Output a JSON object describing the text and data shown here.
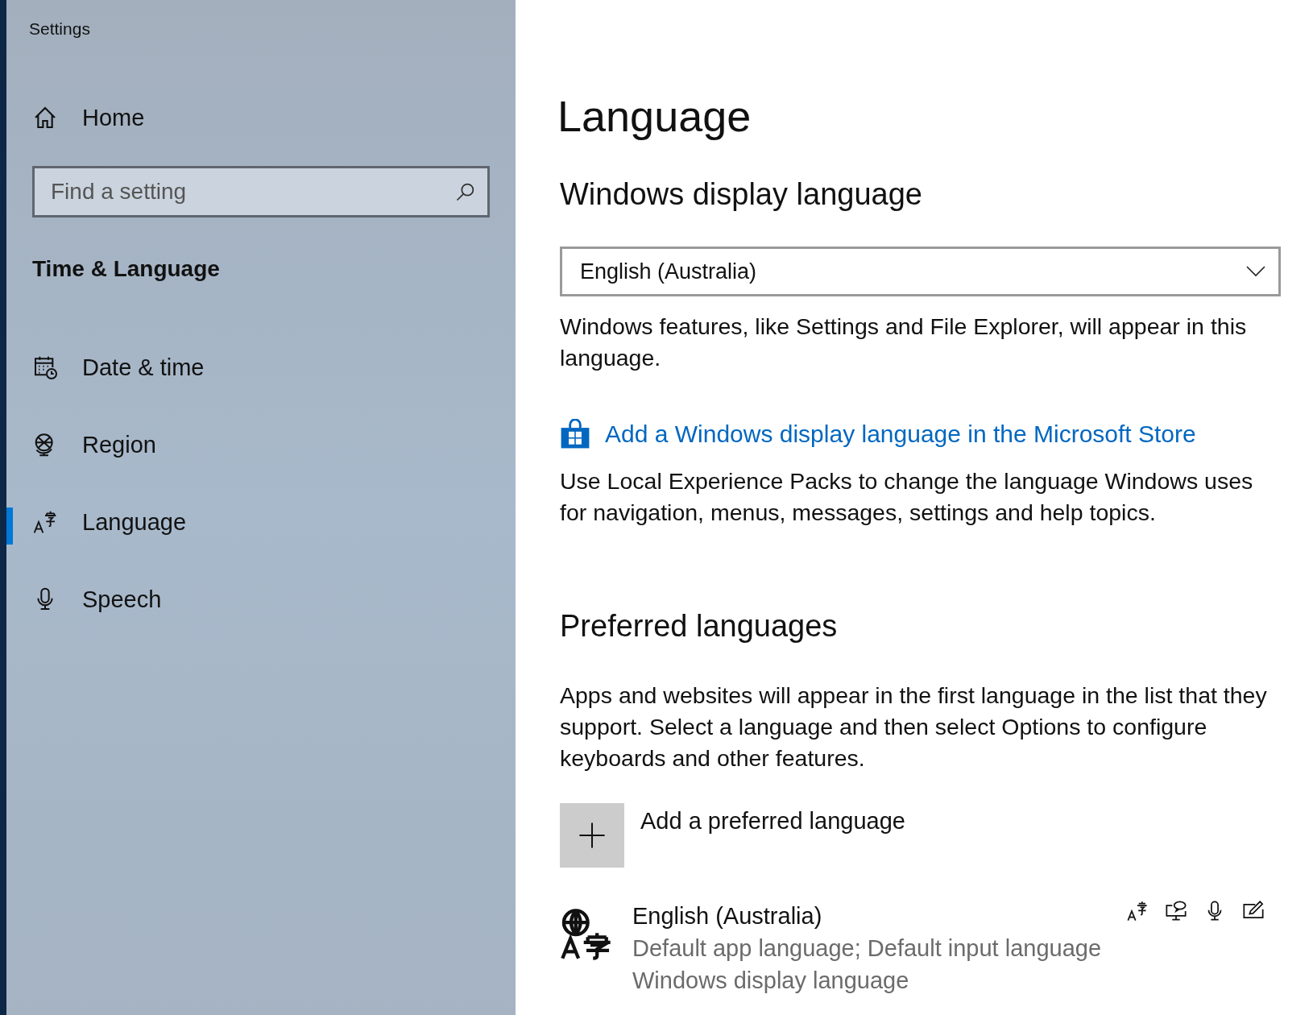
{
  "window": {
    "title": "Settings"
  },
  "sidebar": {
    "home": "Home",
    "search": {
      "placeholder": "Find a setting"
    },
    "section": "Time & Language",
    "items": [
      {
        "label": "Date & time",
        "kind": "date-time",
        "selected": false
      },
      {
        "label": "Region",
        "kind": "region",
        "selected": false
      },
      {
        "label": "Language",
        "kind": "language",
        "selected": true
      },
      {
        "label": "Speech",
        "kind": "speech",
        "selected": false
      }
    ]
  },
  "main": {
    "title": "Language",
    "display_language": {
      "heading": "Windows display language",
      "dropdown_value": "English (Australia)",
      "description": "Windows features, like Settings and File Explorer, will appear in this language.",
      "store_link": "Add a Windows display language in the Microsoft Store",
      "note": "Use Local Experience Packs to change the language Windows uses for navigation, menus, messages, settings and help topics."
    },
    "preferred": {
      "heading": "Preferred languages",
      "description": "Apps and websites will appear in the first language in the list that they support. Select a language and then select Options to configure keyboards and other features.",
      "add_button": "Add a preferred language",
      "languages": [
        {
          "name": "English (Australia)",
          "details": [
            "Default app language; Default input language",
            "Windows display language"
          ]
        }
      ]
    }
  }
}
